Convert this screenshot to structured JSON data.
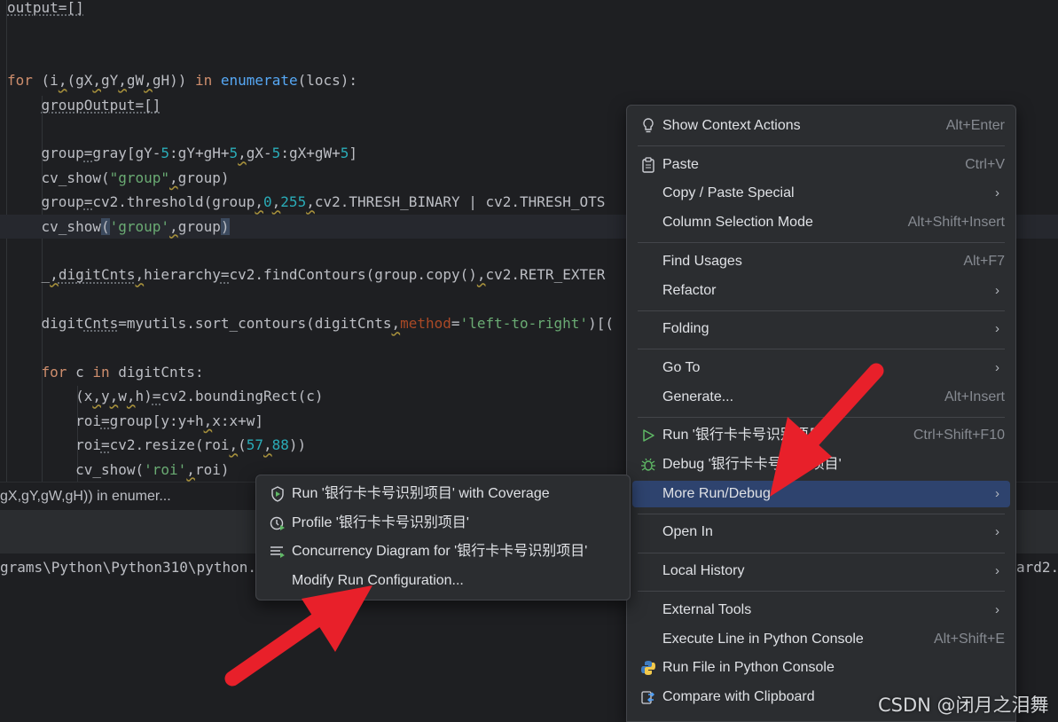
{
  "editor": {
    "lines": [
      {
        "segments": [
          {
            "t": "output",
            "c": "u"
          },
          {
            "t": "=[]",
            "c": "u"
          }
        ]
      },
      {
        "segments": []
      },
      {
        "segments": []
      },
      {
        "segments": [
          {
            "t": "for",
            "c": "kw"
          },
          {
            "t": " (i"
          },
          {
            "t": ",",
            "c": "w"
          },
          {
            "t": "(gX"
          },
          {
            "t": ",",
            "c": "w"
          },
          {
            "t": "gY"
          },
          {
            "t": ",",
            "c": "w"
          },
          {
            "t": "gW"
          },
          {
            "t": ",",
            "c": "w"
          },
          {
            "t": "gH)) "
          },
          {
            "t": "in",
            "c": "kw"
          },
          {
            "t": " "
          },
          {
            "t": "enumerate",
            "c": "fn"
          },
          {
            "t": "(locs):"
          }
        ]
      },
      {
        "segments": [
          {
            "t": "    "
          },
          {
            "t": "groupOutput=[]",
            "c": "u"
          }
        ]
      },
      {
        "segments": []
      },
      {
        "segments": [
          {
            "t": "    group"
          },
          {
            "t": "=",
            "c": "u"
          },
          {
            "t": "gray[gY-"
          },
          {
            "t": "5",
            "c": "num"
          },
          {
            "t": ":gY+gH+"
          },
          {
            "t": "5",
            "c": "num"
          },
          {
            "t": ",",
            "c": "w"
          },
          {
            "t": "gX-"
          },
          {
            "t": "5",
            "c": "num"
          },
          {
            "t": ":gX+gW+"
          },
          {
            "t": "5",
            "c": "num"
          },
          {
            "t": "]"
          }
        ]
      },
      {
        "segments": [
          {
            "t": "    cv_show("
          },
          {
            "t": "\"group\"",
            "c": "str"
          },
          {
            "t": ",",
            "c": "w"
          },
          {
            "t": "group)"
          }
        ]
      },
      {
        "segments": [
          {
            "t": "    group"
          },
          {
            "t": "=",
            "c": "u"
          },
          {
            "t": "cv2.threshold(group"
          },
          {
            "t": ",",
            "c": "w"
          },
          {
            "t": "0",
            "c": "num"
          },
          {
            "t": ",",
            "c": "w"
          },
          {
            "t": "255",
            "c": "num"
          },
          {
            "t": ",",
            "c": "w"
          },
          {
            "t": "cv2.THRESH_BINARY | cv2.THRESH_OTS"
          }
        ]
      },
      {
        "segments": [
          {
            "t": "    cv_show"
          },
          {
            "t": "(",
            "c": "br"
          },
          {
            "t": "'group'",
            "c": "str"
          },
          {
            "t": ",",
            "c": "w"
          },
          {
            "t": "group"
          },
          {
            "t": ")",
            "c": "br"
          }
        ],
        "current": true
      },
      {
        "segments": []
      },
      {
        "segments": [
          {
            "t": "    _"
          },
          {
            "t": ",",
            "c": "w"
          },
          {
            "t": "digitCnts",
            "c": "u"
          },
          {
            "t": ",",
            "c": "w"
          },
          {
            "t": "hierarchy"
          },
          {
            "t": "=",
            "c": "u"
          },
          {
            "t": "cv2.findContours(group.copy()"
          },
          {
            "t": ",",
            "c": "w"
          },
          {
            "t": "cv2.RETR_EXTER"
          }
        ]
      },
      {
        "segments": []
      },
      {
        "segments": [
          {
            "t": "    digit"
          },
          {
            "t": "Cnts",
            "c": "u"
          },
          {
            "t": "=myutils.sort_contours(digitCnts"
          },
          {
            "t": ",",
            "c": "w"
          },
          {
            "t": "method",
            "c": "param"
          },
          {
            "t": "="
          },
          {
            "t": "'left-to-right'",
            "c": "str"
          },
          {
            "t": ")[("
          }
        ]
      },
      {
        "segments": []
      },
      {
        "segments": [
          {
            "t": "    "
          },
          {
            "t": "for",
            "c": "kw"
          },
          {
            "t": " c "
          },
          {
            "t": "in",
            "c": "kw"
          },
          {
            "t": " digitCnts:"
          }
        ]
      },
      {
        "segments": [
          {
            "t": "        (x"
          },
          {
            "t": ",",
            "c": "w"
          },
          {
            "t": "y"
          },
          {
            "t": ",",
            "c": "w"
          },
          {
            "t": "w"
          },
          {
            "t": ",",
            "c": "w"
          },
          {
            "t": "h)"
          },
          {
            "t": "=",
            "c": "u"
          },
          {
            "t": "cv2.boundingRect(c)"
          }
        ]
      },
      {
        "segments": [
          {
            "t": "        roi"
          },
          {
            "t": "=",
            "c": "u"
          },
          {
            "t": "group[y:y+h"
          },
          {
            "t": ",",
            "c": "w"
          },
          {
            "t": "x:x+w]"
          }
        ]
      },
      {
        "segments": [
          {
            "t": "        roi"
          },
          {
            "t": "=",
            "c": "u"
          },
          {
            "t": "cv2.resize(roi"
          },
          {
            "t": ",",
            "c": "w"
          },
          {
            "t": "("
          },
          {
            "t": "57",
            "c": "num"
          },
          {
            "t": ",",
            "c": "w"
          },
          {
            "t": "88",
            "c": "num"
          },
          {
            "t": "))"
          }
        ]
      },
      {
        "segments": [
          {
            "t": "        cv_show("
          },
          {
            "t": "'roi'",
            "c": "str"
          },
          {
            "t": ",",
            "c": "w"
          },
          {
            "t": "roi)"
          }
        ]
      }
    ]
  },
  "breadcrumb": {
    "text": "gX,gY,gW,gH)) in enumer..."
  },
  "console": {
    "path": "grams\\Python\\Python310\\python.",
    "tail": "ard2."
  },
  "context_menu": {
    "items": [
      {
        "label": "Show Context Actions",
        "shortcut": "Alt+Enter",
        "icon": "lightbulb-icon"
      },
      {
        "sep": true
      },
      {
        "label": "Paste",
        "shortcut": "Ctrl+V",
        "icon": "clipboard-icon"
      },
      {
        "label": "Copy / Paste Special",
        "submenu": true
      },
      {
        "label": "Column Selection Mode",
        "shortcut": "Alt+Shift+Insert"
      },
      {
        "sep": true
      },
      {
        "label": "Find Usages",
        "shortcut": "Alt+F7"
      },
      {
        "label": "Refactor",
        "submenu": true
      },
      {
        "sep": true
      },
      {
        "label": "Folding",
        "submenu": true
      },
      {
        "sep": true
      },
      {
        "label": "Go To",
        "submenu": true
      },
      {
        "label": "Generate...",
        "shortcut": "Alt+Insert"
      },
      {
        "sep": true
      },
      {
        "label": "Run '银行卡卡号识别项目'",
        "shortcut": "Ctrl+Shift+F10",
        "icon": "run-icon"
      },
      {
        "label": "Debug '银行卡卡号识别项目'",
        "icon": "debug-icon"
      },
      {
        "label": "More Run/Debug",
        "submenu": true,
        "selected": true
      },
      {
        "sep": true
      },
      {
        "label": "Open In",
        "submenu": true
      },
      {
        "sep": true
      },
      {
        "label": "Local History",
        "submenu": true
      },
      {
        "sep": true
      },
      {
        "label": "External Tools",
        "submenu": true
      },
      {
        "label": "Execute Line in Python Console",
        "shortcut": "Alt+Shift+E"
      },
      {
        "label": "Run File in Python Console",
        "icon": "python-icon"
      },
      {
        "label": "Compare with Clipboard",
        "icon": "compare-icon"
      }
    ]
  },
  "submenu": {
    "items": [
      {
        "label": "Run '银行卡卡号识别项目' with Coverage",
        "icon": "coverage-icon"
      },
      {
        "label": "Profile '银行卡卡号识别项目'",
        "icon": "profile-icon"
      },
      {
        "label": "Concurrency Diagram for '银行卡卡号识别项目'",
        "icon": "concurrency-icon"
      },
      {
        "label": "Modify Run Configuration..."
      }
    ]
  },
  "watermark": "CSDN @闭月之泪舞",
  "colors": {
    "accent": "#2e436e",
    "arrow": "#e8202a",
    "menu_bg": "#2b2d30",
    "editor_bg": "#1e1f22"
  }
}
